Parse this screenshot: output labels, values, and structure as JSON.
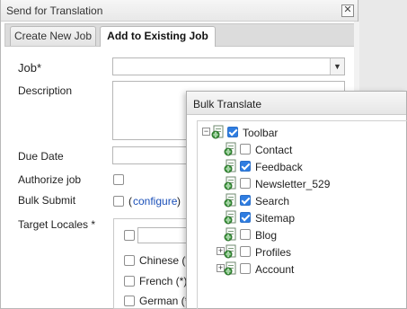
{
  "dialog": {
    "title": "Send for Translation",
    "close_symbol": "✕",
    "tabs": [
      {
        "label": "Create New Job",
        "active": false
      },
      {
        "label": "Add to Existing Job",
        "active": true
      }
    ],
    "fields": {
      "job_label": "Job*",
      "job_value": "",
      "description_label": "Description",
      "description_value": "",
      "due_date_label": "Due Date",
      "due_date_value": "",
      "authorize_label": "Authorize job",
      "authorize_checked": false,
      "bulk_submit_label": "Bulk Submit",
      "bulk_submit_checked": false,
      "configure_open": "(",
      "configure_link": "configure",
      "configure_close": ")",
      "target_locales_label": "Target Locales *"
    },
    "locales": [
      {
        "label": "Chinese (*",
        "checked": false
      },
      {
        "label": "French (*)",
        "checked": false
      },
      {
        "label": "German (*",
        "checked": false
      }
    ],
    "locale_filter_value": ""
  },
  "bulk": {
    "title": "Bulk Translate",
    "tree": [
      {
        "label": "Toolbar",
        "checked": true,
        "expander": "minus",
        "level": 0
      },
      {
        "label": "Contact",
        "checked": false,
        "expander": "none",
        "level": 1
      },
      {
        "label": "Feedback",
        "checked": true,
        "expander": "none",
        "level": 1
      },
      {
        "label": "Newsletter_529",
        "checked": false,
        "expander": "none",
        "level": 1
      },
      {
        "label": "Search",
        "checked": true,
        "expander": "none",
        "level": 1
      },
      {
        "label": "Sitemap",
        "checked": true,
        "expander": "none",
        "level": 1
      },
      {
        "label": "Blog",
        "checked": false,
        "expander": "none",
        "level": 1
      },
      {
        "label": "Profiles",
        "checked": false,
        "expander": "plus",
        "level": 1
      },
      {
        "label": "Account",
        "checked": false,
        "expander": "plus",
        "level": 1
      }
    ]
  },
  "icons": {
    "page_icon": "page-globe-icon",
    "expand": "+",
    "collapse": "−",
    "dropdown": "▼"
  },
  "colors": {
    "checkbox_checked": "#2f7de1",
    "link": "#1a4fb8"
  }
}
